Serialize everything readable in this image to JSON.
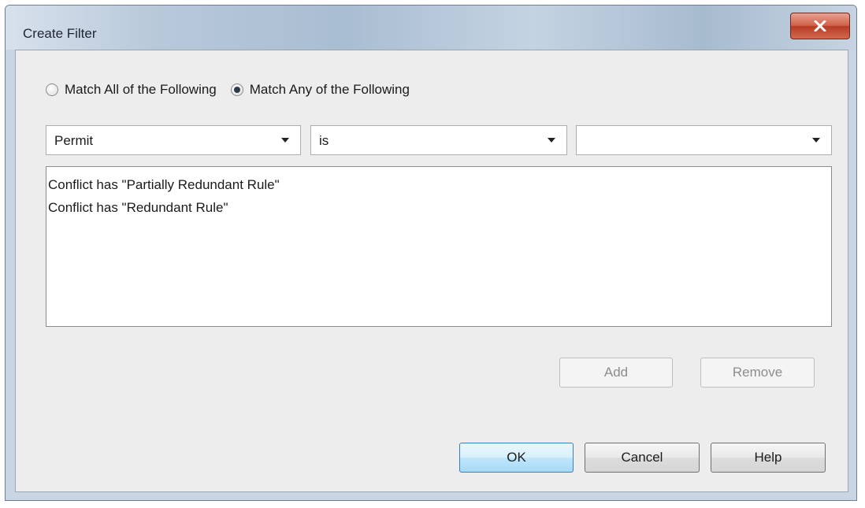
{
  "window": {
    "title": "Create Filter",
    "close_glyph": "x"
  },
  "match": {
    "all_label": "Match All of the Following",
    "any_label": "Match Any of the Following",
    "selected": "any"
  },
  "criteria_row": {
    "field_value": "Permit",
    "operator_value": "is",
    "value_value": ""
  },
  "criteria_list": [
    "Conflict has \"Partially Redundant Rule\"",
    "Conflict has \"Redundant Rule\""
  ],
  "buttons": {
    "add": "Add",
    "remove": "Remove",
    "ok": "OK",
    "cancel": "Cancel",
    "help": "Help"
  }
}
